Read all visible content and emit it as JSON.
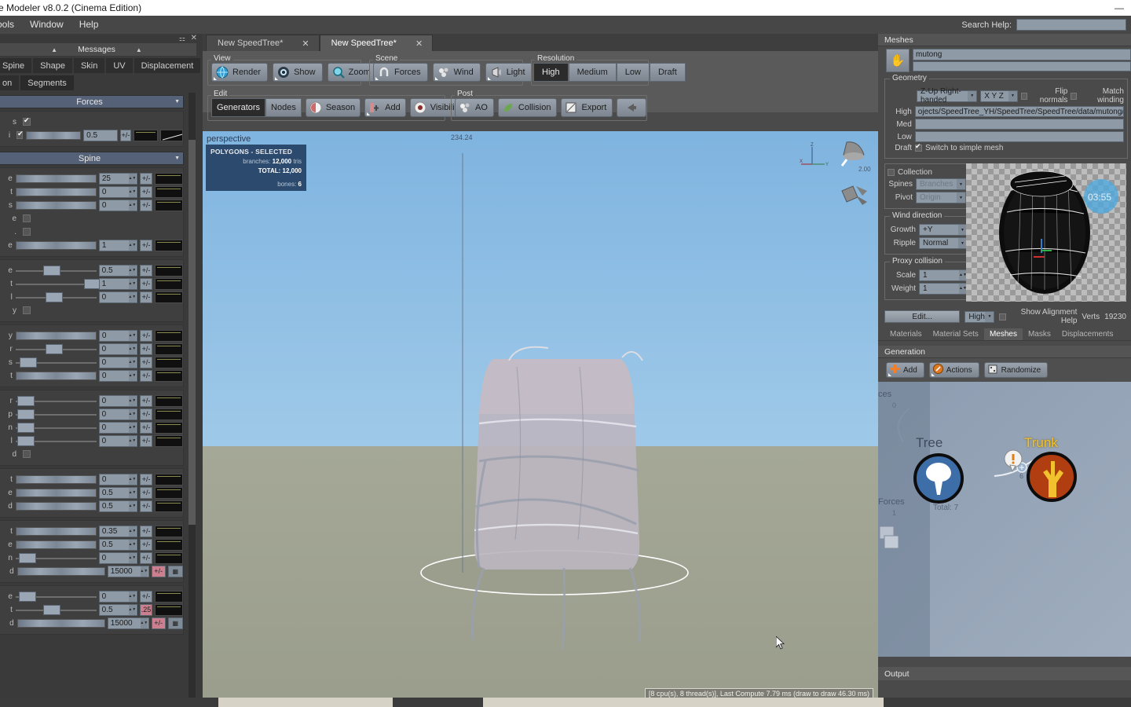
{
  "window": {
    "title": "e Modeler v8.0.2 (Cinema Edition)",
    "minimize": "—",
    "maximize": "▭",
    "close": "✕"
  },
  "menubar": {
    "items": [
      "ools",
      "Window",
      "Help"
    ],
    "search_label": "Search Help:",
    "search_value": "",
    "search_placeholder": ""
  },
  "left_panel": {
    "pin_icon": "pin-icon",
    "close_icon": "✕",
    "messages_label": "Messages",
    "caret_left": "▲",
    "caret_right": "▲",
    "tabs_row1": [
      "Spine",
      "Shape",
      "Skin",
      "UV",
      "Displacement"
    ],
    "tabs_row2": [
      "on",
      "Segments"
    ],
    "sections": [
      {
        "title": "Forces",
        "arrow": "▼"
      },
      {
        "title": "Spine",
        "arrow": "▼"
      }
    ],
    "forces_rows": [
      {
        "label": "s",
        "type": "checkbox",
        "checked": true
      },
      {
        "label": "i",
        "type": "slider",
        "value": "0.5",
        "pm": "+/-",
        "fill": 0.62
      }
    ],
    "spine_rows": [
      {
        "label": "e",
        "value": "25",
        "pm": "+/-",
        "fill": 1.0
      },
      {
        "label": "t",
        "value": "0",
        "pm": "+/-",
        "fill": 1.0
      },
      {
        "label": "s",
        "value": "0",
        "pm": "+/-",
        "fill": 1.0
      },
      {
        "label": "e",
        "type": "checkbox",
        "checked": false
      },
      {
        "label": ".",
        "type": "checkbox",
        "checked": false
      },
      {
        "label": "e",
        "value": "1",
        "pm": "+/-",
        "fill": 1.0
      }
    ],
    "group2_rows": [
      {
        "label": "e",
        "value": "0.5",
        "pm": "+/-",
        "knob": 0.33
      },
      {
        "label": "t",
        "value": "1",
        "pm": "+/-",
        "knob": 0.82
      },
      {
        "label": "l",
        "value": "0",
        "pm": "+/-",
        "knob": 0.36
      },
      {
        "label": "y",
        "type": "checkbox",
        "checked": false
      }
    ],
    "group3_rows": [
      {
        "label": "y",
        "value": "0",
        "pm": "+/-",
        "fill": 1.0
      },
      {
        "label": "r",
        "value": "0",
        "pm": "+/-",
        "knob": 0.36
      },
      {
        "label": "s",
        "value": "0",
        "pm": "+/-",
        "knob": 0.05
      },
      {
        "label": "t",
        "value": "0",
        "pm": "+/-",
        "fill": 1.0
      }
    ],
    "group4_rows": [
      {
        "label": "r",
        "value": "0",
        "pm": "+/-",
        "knob": 0.02
      },
      {
        "label": "p",
        "value": "0",
        "pm": "+/-",
        "knob": 0.02
      },
      {
        "label": "n",
        "value": "0",
        "pm": "+/-",
        "knob": 0.02
      },
      {
        "label": "l",
        "value": "0",
        "pm": "+/-",
        "knob": 0.02
      },
      {
        "label": "d",
        "type": "checkbox",
        "checked": false
      }
    ],
    "group5_rows": [
      {
        "label": "t",
        "value": "0",
        "pm": "+/-",
        "fill": 1.0
      },
      {
        "label": "e",
        "value": "0.5",
        "pm": "+/-",
        "fill": 1.0
      },
      {
        "label": "d",
        "value": "0.5",
        "pm": "+/-",
        "fill": 1.0
      }
    ],
    "group6_rows": [
      {
        "label": "t",
        "value": "0.35",
        "pm": "+/-",
        "fill": 1.0
      },
      {
        "label": "e",
        "value": "0.5",
        "pm": "+/-",
        "fill": 1.0
      },
      {
        "label": "n",
        "value": "0",
        "pm": "+/-",
        "knob": 0.04
      },
      {
        "label": "d",
        "value": "15000",
        "pm": "+/-",
        "fill": 1.0,
        "red": true,
        "noise": true
      }
    ],
    "group7_rows": [
      {
        "label": "e",
        "value": "0",
        "pm": "+/-",
        "knob": 0.04
      },
      {
        "label": "t",
        "value": "0.5",
        "pm": ".25",
        "knob": 0.33,
        "red": true
      },
      {
        "label": "d",
        "value": "15000",
        "pm": "+/-",
        "fill": 1.0,
        "red": true,
        "noise": true
      }
    ]
  },
  "center": {
    "doc_tabs": [
      {
        "label": "New SpeedTree*",
        "close": "✕",
        "active": false
      },
      {
        "label": "New SpeedTree*",
        "close": "✕",
        "active": true
      }
    ],
    "toolbar": {
      "view": {
        "label": "View",
        "buttons": [
          {
            "label": "Render",
            "icon": "globe-icon"
          },
          {
            "label": "Show",
            "icon": "eye-icon"
          },
          {
            "label": "Zoom",
            "icon": "magnifier-icon"
          }
        ]
      },
      "scene": {
        "label": "Scene",
        "buttons": [
          {
            "label": "Forces",
            "icon": "magnet-icon"
          },
          {
            "label": "Wind",
            "icon": "wind-icon"
          },
          {
            "label": "Light",
            "icon": "light-icon"
          }
        ]
      },
      "resolution": {
        "label": "Resolution",
        "options": [
          "High",
          "Medium",
          "Low",
          "Draft"
        ],
        "selected": "High"
      },
      "edit": {
        "label": "Edit",
        "segmented": [
          "Generators",
          "Nodes"
        ],
        "segmented_selected": "Generators",
        "buttons": [
          {
            "label": "Season",
            "icon": "season-icon"
          },
          {
            "label": "Add",
            "icon": "add-icon"
          },
          {
            "label": "Visibility",
            "icon": "visibility-icon"
          }
        ]
      },
      "post": {
        "label": "Post",
        "buttons": [
          {
            "label": "AO",
            "icon": "ao-icon"
          },
          {
            "label": "Collision",
            "icon": "collision-icon"
          },
          {
            "label": "Export",
            "icon": "export-icon"
          },
          {
            "label": "",
            "icon": "back-arrow-icon"
          }
        ]
      }
    },
    "viewport": {
      "camera_label": "perspective",
      "stats_overlay": {
        "header": "POLYGONS - SELECTED",
        "rows": [
          {
            "label": "branches:",
            "value": "12,000",
            "unit": "tris"
          },
          {
            "label": "TOTAL:",
            "value": "12,000",
            "unit": ""
          },
          {
            "label": "bones:",
            "value": "6",
            "unit": ""
          }
        ]
      },
      "height_label": "234.24",
      "gizmo_axes": [
        "Z",
        "X",
        "Y"
      ],
      "light_value": "2.00",
      "status_text": "[8 cpu(s), 8 thread(s)], Last Compute 7.79 ms (draw to draw 46.30 ms)"
    }
  },
  "right_panel": {
    "meshes_header": "Meshes",
    "hand_icon": "hand-icon",
    "mesh_name": "mutong",
    "geometry": {
      "label": "Geometry",
      "orientation": "Z-Up Right-handed",
      "axis_order": "X Y Z",
      "flip_normals_label": "Flip normals",
      "flip_normals_checked": false,
      "match_winding_label": "Match winding",
      "match_winding_checked": false,
      "lods": [
        {
          "label": "High",
          "value": "ojects/SpeedTree_YH/SpeedTree/SpeedTree/data/mutong/mutong.FBX"
        },
        {
          "label": "Med",
          "value": ""
        },
        {
          "label": "Low",
          "value": ""
        }
      ],
      "draft_label": "Draft",
      "draft_checkbox_checked": true,
      "draft_text": "Switch to simple mesh"
    },
    "collection": {
      "label": "Collection",
      "checked": false,
      "spines_label": "Spines",
      "spines_value": "Branches",
      "pivot_label": "Pivot",
      "pivot_value": "Origin"
    },
    "wind_direction": {
      "label": "Wind direction",
      "growth_label": "Growth",
      "growth_value": "+Y",
      "ripple_label": "Ripple",
      "ripple_value": "Normal"
    },
    "proxy_collision": {
      "label": "Proxy collision",
      "scale_label": "Scale",
      "scale_value": "1",
      "weight_label": "Weight",
      "weight_value": "1"
    },
    "preview": {
      "badge_time": "03:55",
      "object": "barrel-mesh"
    },
    "footer": {
      "edit_button": "Edit...",
      "lod_value": "High",
      "alignment_label": "Show Alignment Help",
      "alignment_checked": false,
      "verts_label": "Verts",
      "verts_value": "19230"
    },
    "tabs": [
      "Materials",
      "Material Sets",
      "Meshes",
      "Masks",
      "Displacements"
    ],
    "tab_selected": "Meshes",
    "generation": {
      "header": "Generation",
      "buttons": [
        {
          "label": "Add",
          "icon": "plus-icon"
        },
        {
          "label": "Actions",
          "icon": "actions-icon"
        },
        {
          "label": "Randomize",
          "icon": "dice-icon"
        }
      ],
      "nodes": [
        {
          "label": "Tree",
          "color": "#3d6ea8",
          "icon": "tree-icon"
        },
        {
          "label": "Trunk",
          "color": "#b03e10",
          "icon": "trunk-icon"
        }
      ],
      "connection_count": "6",
      "total_label": "Total: 7",
      "warning_icon": "!",
      "side_labels": [
        {
          "text": "ces",
          "count": "0"
        },
        {
          "text": "Forces",
          "count": "1"
        }
      ]
    },
    "output_header": "Output"
  },
  "colors": {
    "accent_blue": "#5a7fb8",
    "panel_bg": "#4a4a4a",
    "section_header": "#556177",
    "input_bg": "#8e9aa6",
    "trunk_orange": "#b03e10",
    "trunk_yellow": "#f2c12e",
    "tree_blue": "#3d6ea8",
    "red_button": "#cc7f8e"
  }
}
